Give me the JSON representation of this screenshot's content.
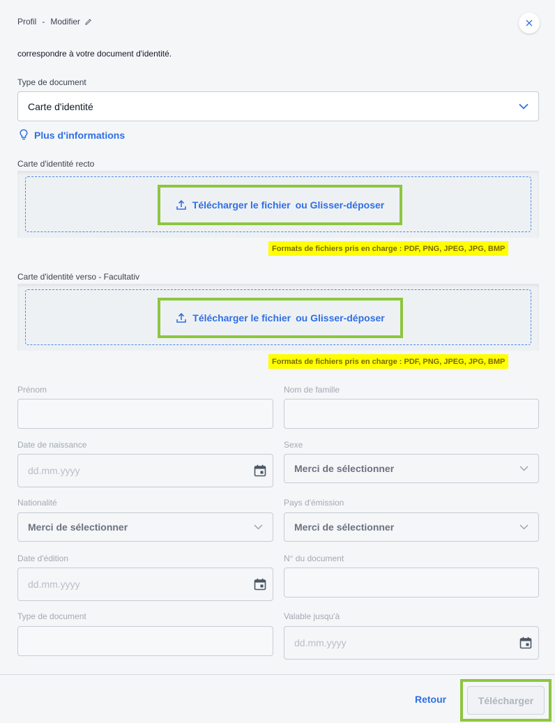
{
  "header": {
    "profile": "Profil",
    "separator": "-",
    "modify": "Modifier"
  },
  "intro_text": "correspondre à votre document d'identité.",
  "document_type": {
    "label": "Type de document",
    "value": "Carte d'identité"
  },
  "info_link": "Plus d'informations",
  "front_upload": {
    "label": "Carte d'identité recto",
    "upload_text": "Télécharger le fichier",
    "or_text": "ou Glisser-déposer",
    "formats": "Formats de fichiers pris en charge : PDF, PNG, JPEG, JPG, BMP"
  },
  "back_upload": {
    "label": "Carte d'identité verso - Facultativ",
    "upload_text": "Télécharger le fichier",
    "or_text": "ou Glisser-déposer",
    "formats": "Formats de fichiers pris en charge : PDF, PNG, JPEG, JPG, BMP"
  },
  "form": {
    "first_name": {
      "label": "Prénom",
      "value": ""
    },
    "last_name": {
      "label": "Nom de famille",
      "value": ""
    },
    "birth_date": {
      "label": "Date de naissance",
      "placeholder": "dd.mm.yyyy"
    },
    "sex": {
      "label": "Sexe",
      "value": "Merci de sélectionner"
    },
    "nationality": {
      "label": "Nationalité",
      "value": "Merci de sélectionner"
    },
    "issuing_country": {
      "label": "Pays d'émission",
      "value": "Merci de sélectionner"
    },
    "issue_date": {
      "label": "Date d'édition",
      "placeholder": "dd.mm.yyyy"
    },
    "document_number": {
      "label": "N° du document",
      "value": ""
    },
    "doc_type": {
      "label": "Type de document",
      "value": ""
    },
    "valid_until": {
      "label": "Valable jusqu'à",
      "placeholder": "dd.mm.yyyy"
    }
  },
  "footer": {
    "back": "Retour",
    "submit": "Télécharger"
  },
  "colors": {
    "accent": "#2f6fe4",
    "highlight_border": "#8dc63f",
    "highlight_fill": "#ffff00"
  },
  "icons": {
    "close": "close-icon",
    "pencil": "pencil-icon",
    "chevron": "chevron-down-icon",
    "bulb": "lightbulb-icon",
    "upload": "upload-icon",
    "calendar": "calendar-icon"
  }
}
